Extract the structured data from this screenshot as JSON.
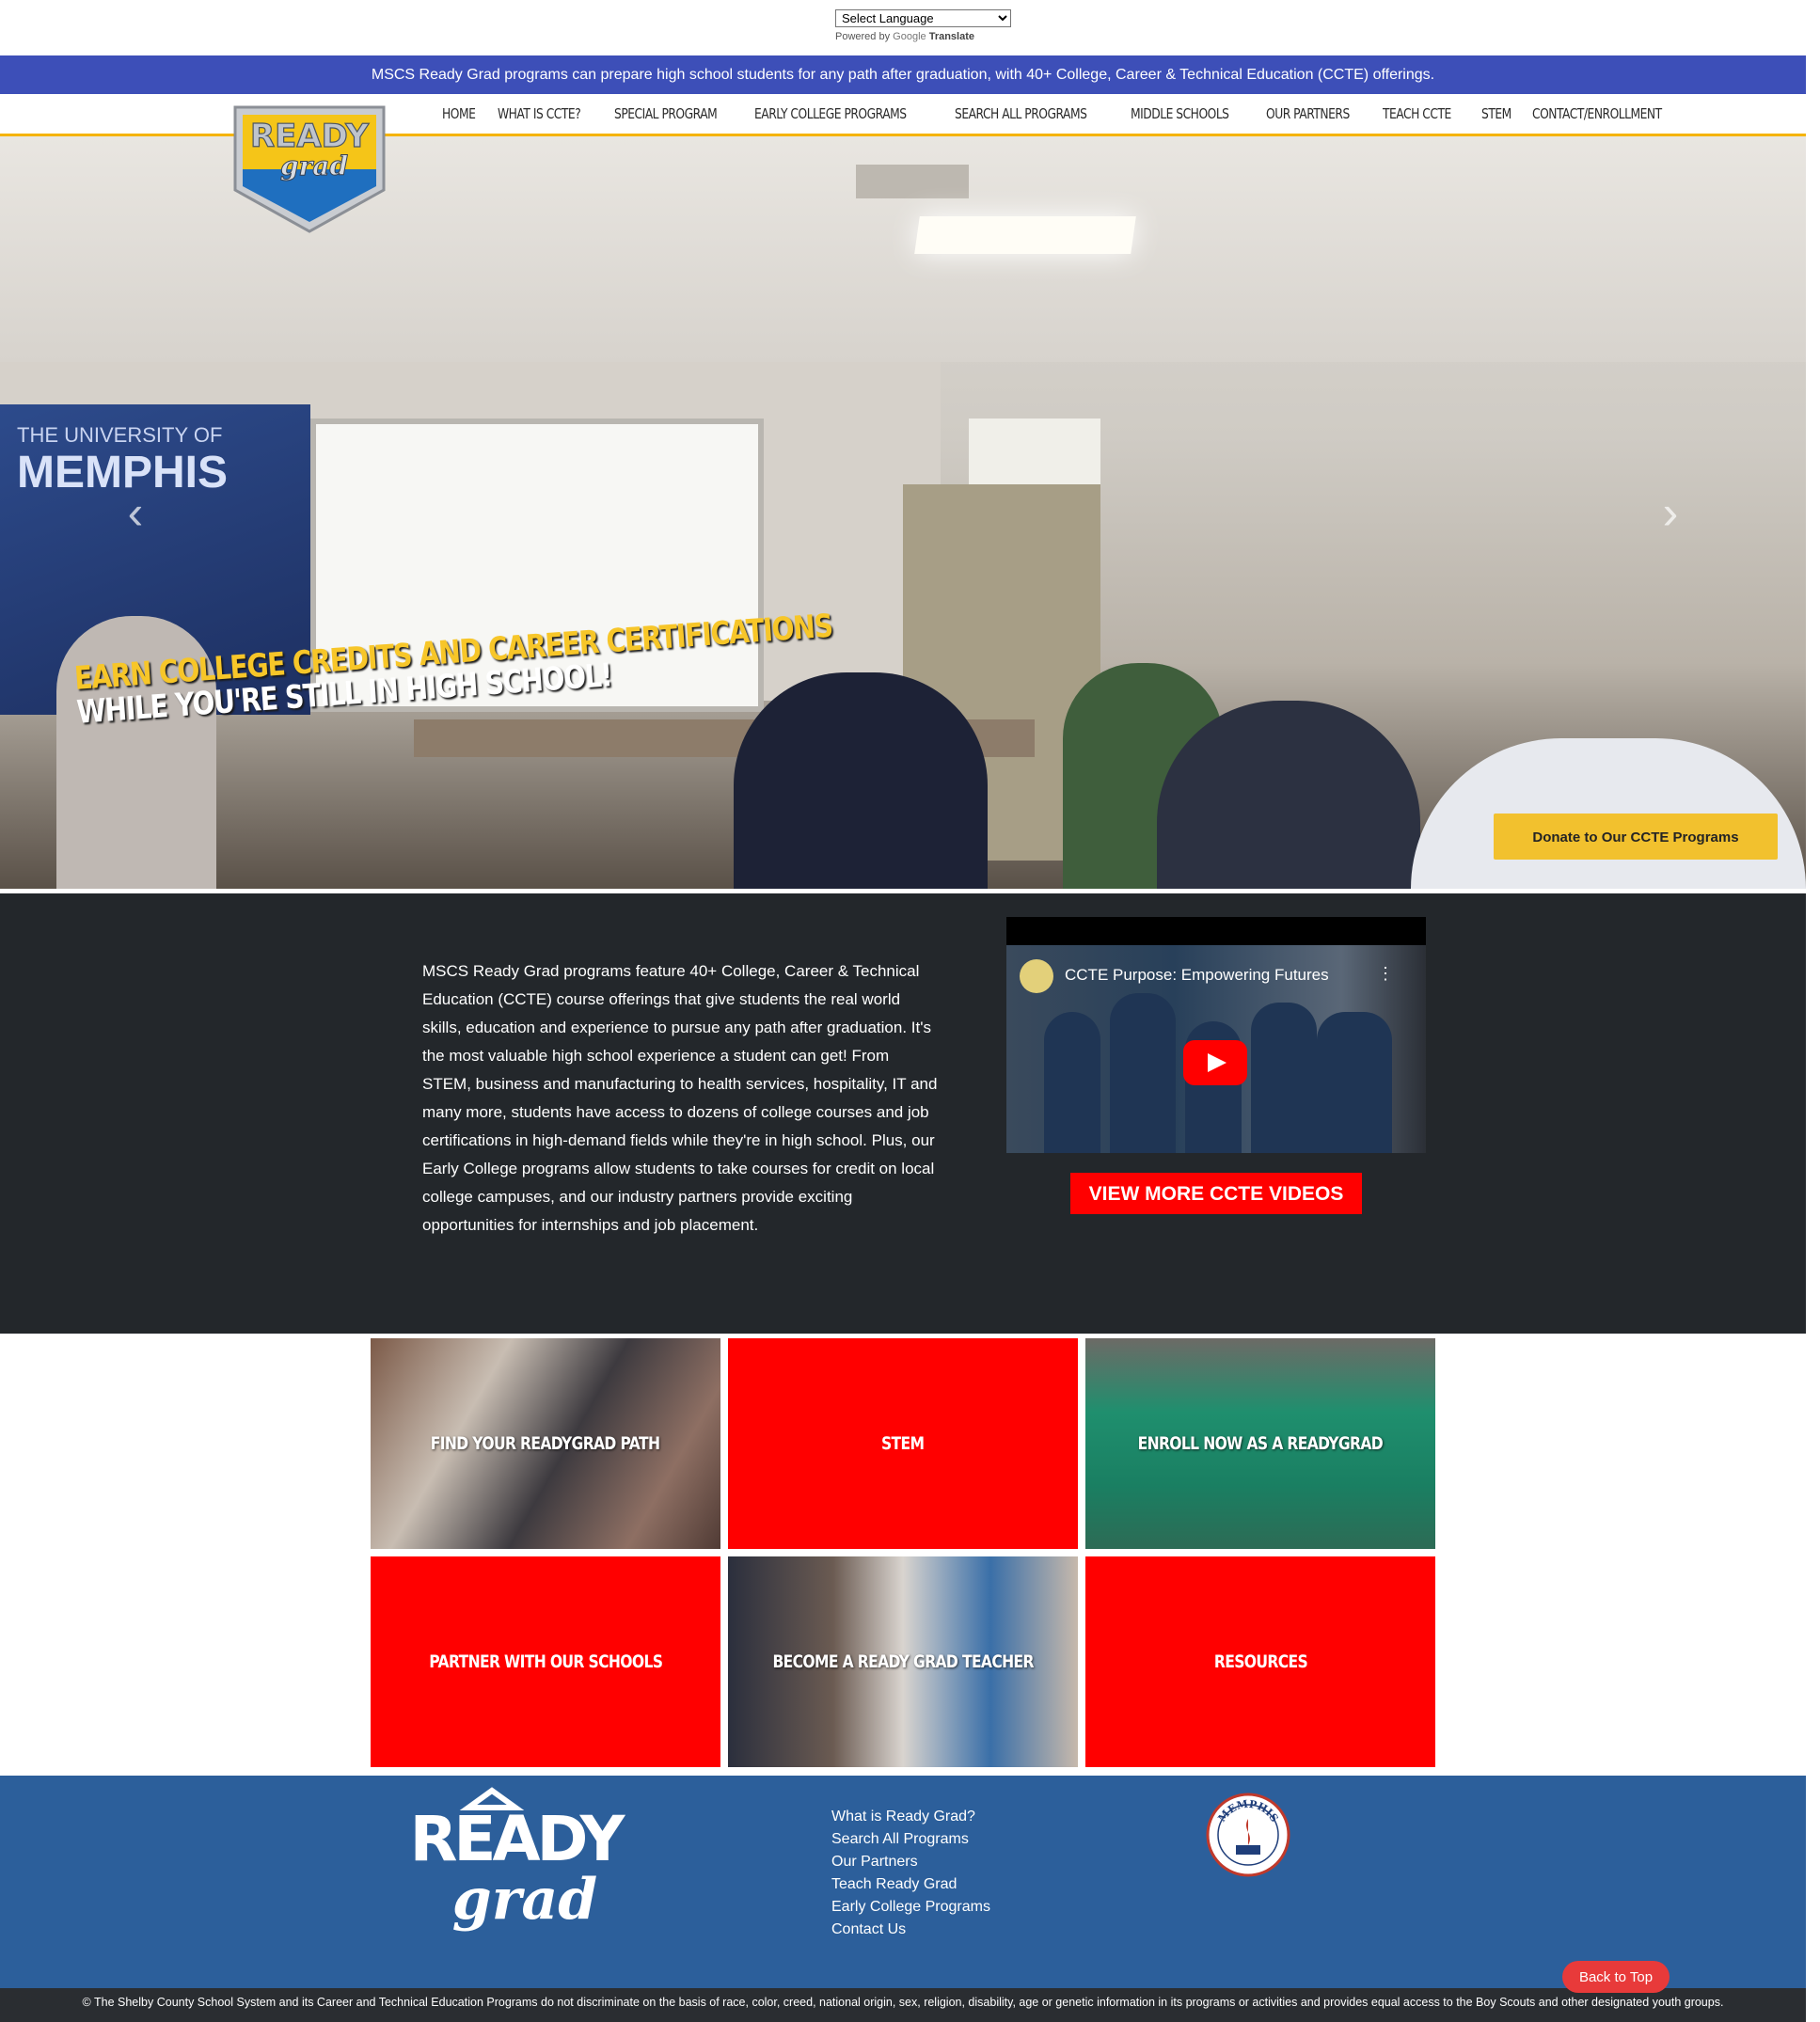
{
  "language": {
    "select_label": "Select Language",
    "powered_by": "Powered by",
    "google": "Google",
    "translate": "Translate"
  },
  "announcement": "MSCS Ready Grad programs can prepare high school students for any path after graduation, with 40+ College, Career & Technical Education (CCTE) offerings.",
  "logo": {
    "line1": "READY",
    "line2": "grad"
  },
  "nav": [
    "HOME",
    "WHAT IS CCTE?",
    "SPECIAL PROGRAM",
    "EARLY COLLEGE PROGRAMS",
    "SEARCH ALL PROGRAMS",
    "MIDDLE SCHOOLS",
    "OUR PARTNERS",
    "TEACH CCTE",
    "STEM",
    "CONTACT/ENROLLMENT"
  ],
  "hero": {
    "headline_1": "EARN COLLEGE CREDITS AND CAREER CERTIFICATIONS",
    "headline_2": "WHILE YOU'RE STILL IN HIGH SCHOOL!",
    "tv_small": "THE UNIVERSITY OF",
    "tv_big": "MEMPHIS",
    "prev_icon": "chevron-left-icon",
    "next_icon": "chevron-right-icon",
    "donate_label": "Donate to Our CCTE Programs",
    "slide_count": 9,
    "active_slide": 1
  },
  "intro": {
    "text": "MSCS Ready Grad programs feature 40+ College, Career & Technical Education (CCTE) course offerings that give students the real world skills, education and experience to pursue any path after graduation. It's the most valuable high school experience a student can get! From STEM, business and manufacturing to health services, hospitality, IT and many more, students have access to dozens of college courses and job certifications in high-demand fields while they're in high school. Plus, our Early College programs allow students to take courses for credit on local college campuses, and our industry partners provide exciting opportunities for internships and job placement.",
    "video_title": "CCTE Purpose: Empowering Futures",
    "more_videos": "VIEW MORE CCTE VIDEOS"
  },
  "tiles": [
    {
      "label": "FIND YOUR READYGRAD PATH",
      "style": "photo"
    },
    {
      "label": "STEM",
      "style": "red"
    },
    {
      "label": "ENROLL NOW AS A READYGRAD",
      "style": "photo"
    },
    {
      "label": "PARTNER WITH OUR SCHOOLS",
      "style": "red"
    },
    {
      "label": "BECOME A READY GRAD TEACHER",
      "style": "photo"
    },
    {
      "label": "RESOURCES",
      "style": "red"
    }
  ],
  "footer": {
    "links": [
      "What is Ready Grad?",
      "Search All Programs",
      "Our Partners",
      "Teach Ready Grad",
      "Early College Programs",
      "Contact Us"
    ],
    "seal_text": "MEMPHIS",
    "back_to_top": "Back to Top",
    "notice": "© The Shelby County School System and its Career and Technical Education Programs do not discriminate on the basis of race, color, creed, national origin, sex, religion, disability, age or genetic information in its programs or activities and provides equal access to the Boy Scouts and other designated youth groups."
  },
  "colors": {
    "announce_bar": "#3d4fb8",
    "accent_gold": "#f2c12e",
    "tile_red": "#ff0000",
    "dark_section": "#23272b",
    "footer_blue": "#2c5f9b"
  }
}
